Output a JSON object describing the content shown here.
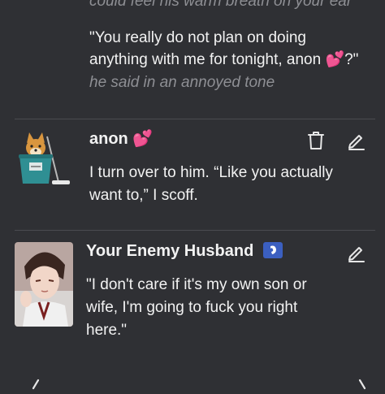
{
  "prev_message": {
    "lines": [
      "could feel his warm breath on your ear",
      "\"You really do not plan on doing",
      "anything with me for tonight, anon 💕?\"",
      "he said in an annoyed tone"
    ]
  },
  "anon_message": {
    "name": "anon 💕",
    "lines": [
      "I turn over to him. “Like you actually",
      "want to,” I scoff."
    ],
    "avatar_icon": "doge-in-bucket-avatar",
    "delete_icon": "trash-icon",
    "edit_icon": "pencil-icon"
  },
  "bot_message": {
    "name": "Your Enemy Husband",
    "badge_icon": "bot-badge-icon",
    "lines": [
      "\"I don't care if it's my own son or",
      "wife, I'm going to fuck you right",
      "here.\""
    ],
    "avatar_icon": "anime-man-avatar",
    "edit_icon": "pencil-icon"
  },
  "nav": {
    "prev_icon": "chevron-left-icon",
    "next_icon": "chevron-right-icon"
  },
  "colors": {
    "background": "#2f3034",
    "text": "#f2f2f2",
    "muted_italic": "#8e8f94",
    "badge": "#3b5fc0"
  }
}
